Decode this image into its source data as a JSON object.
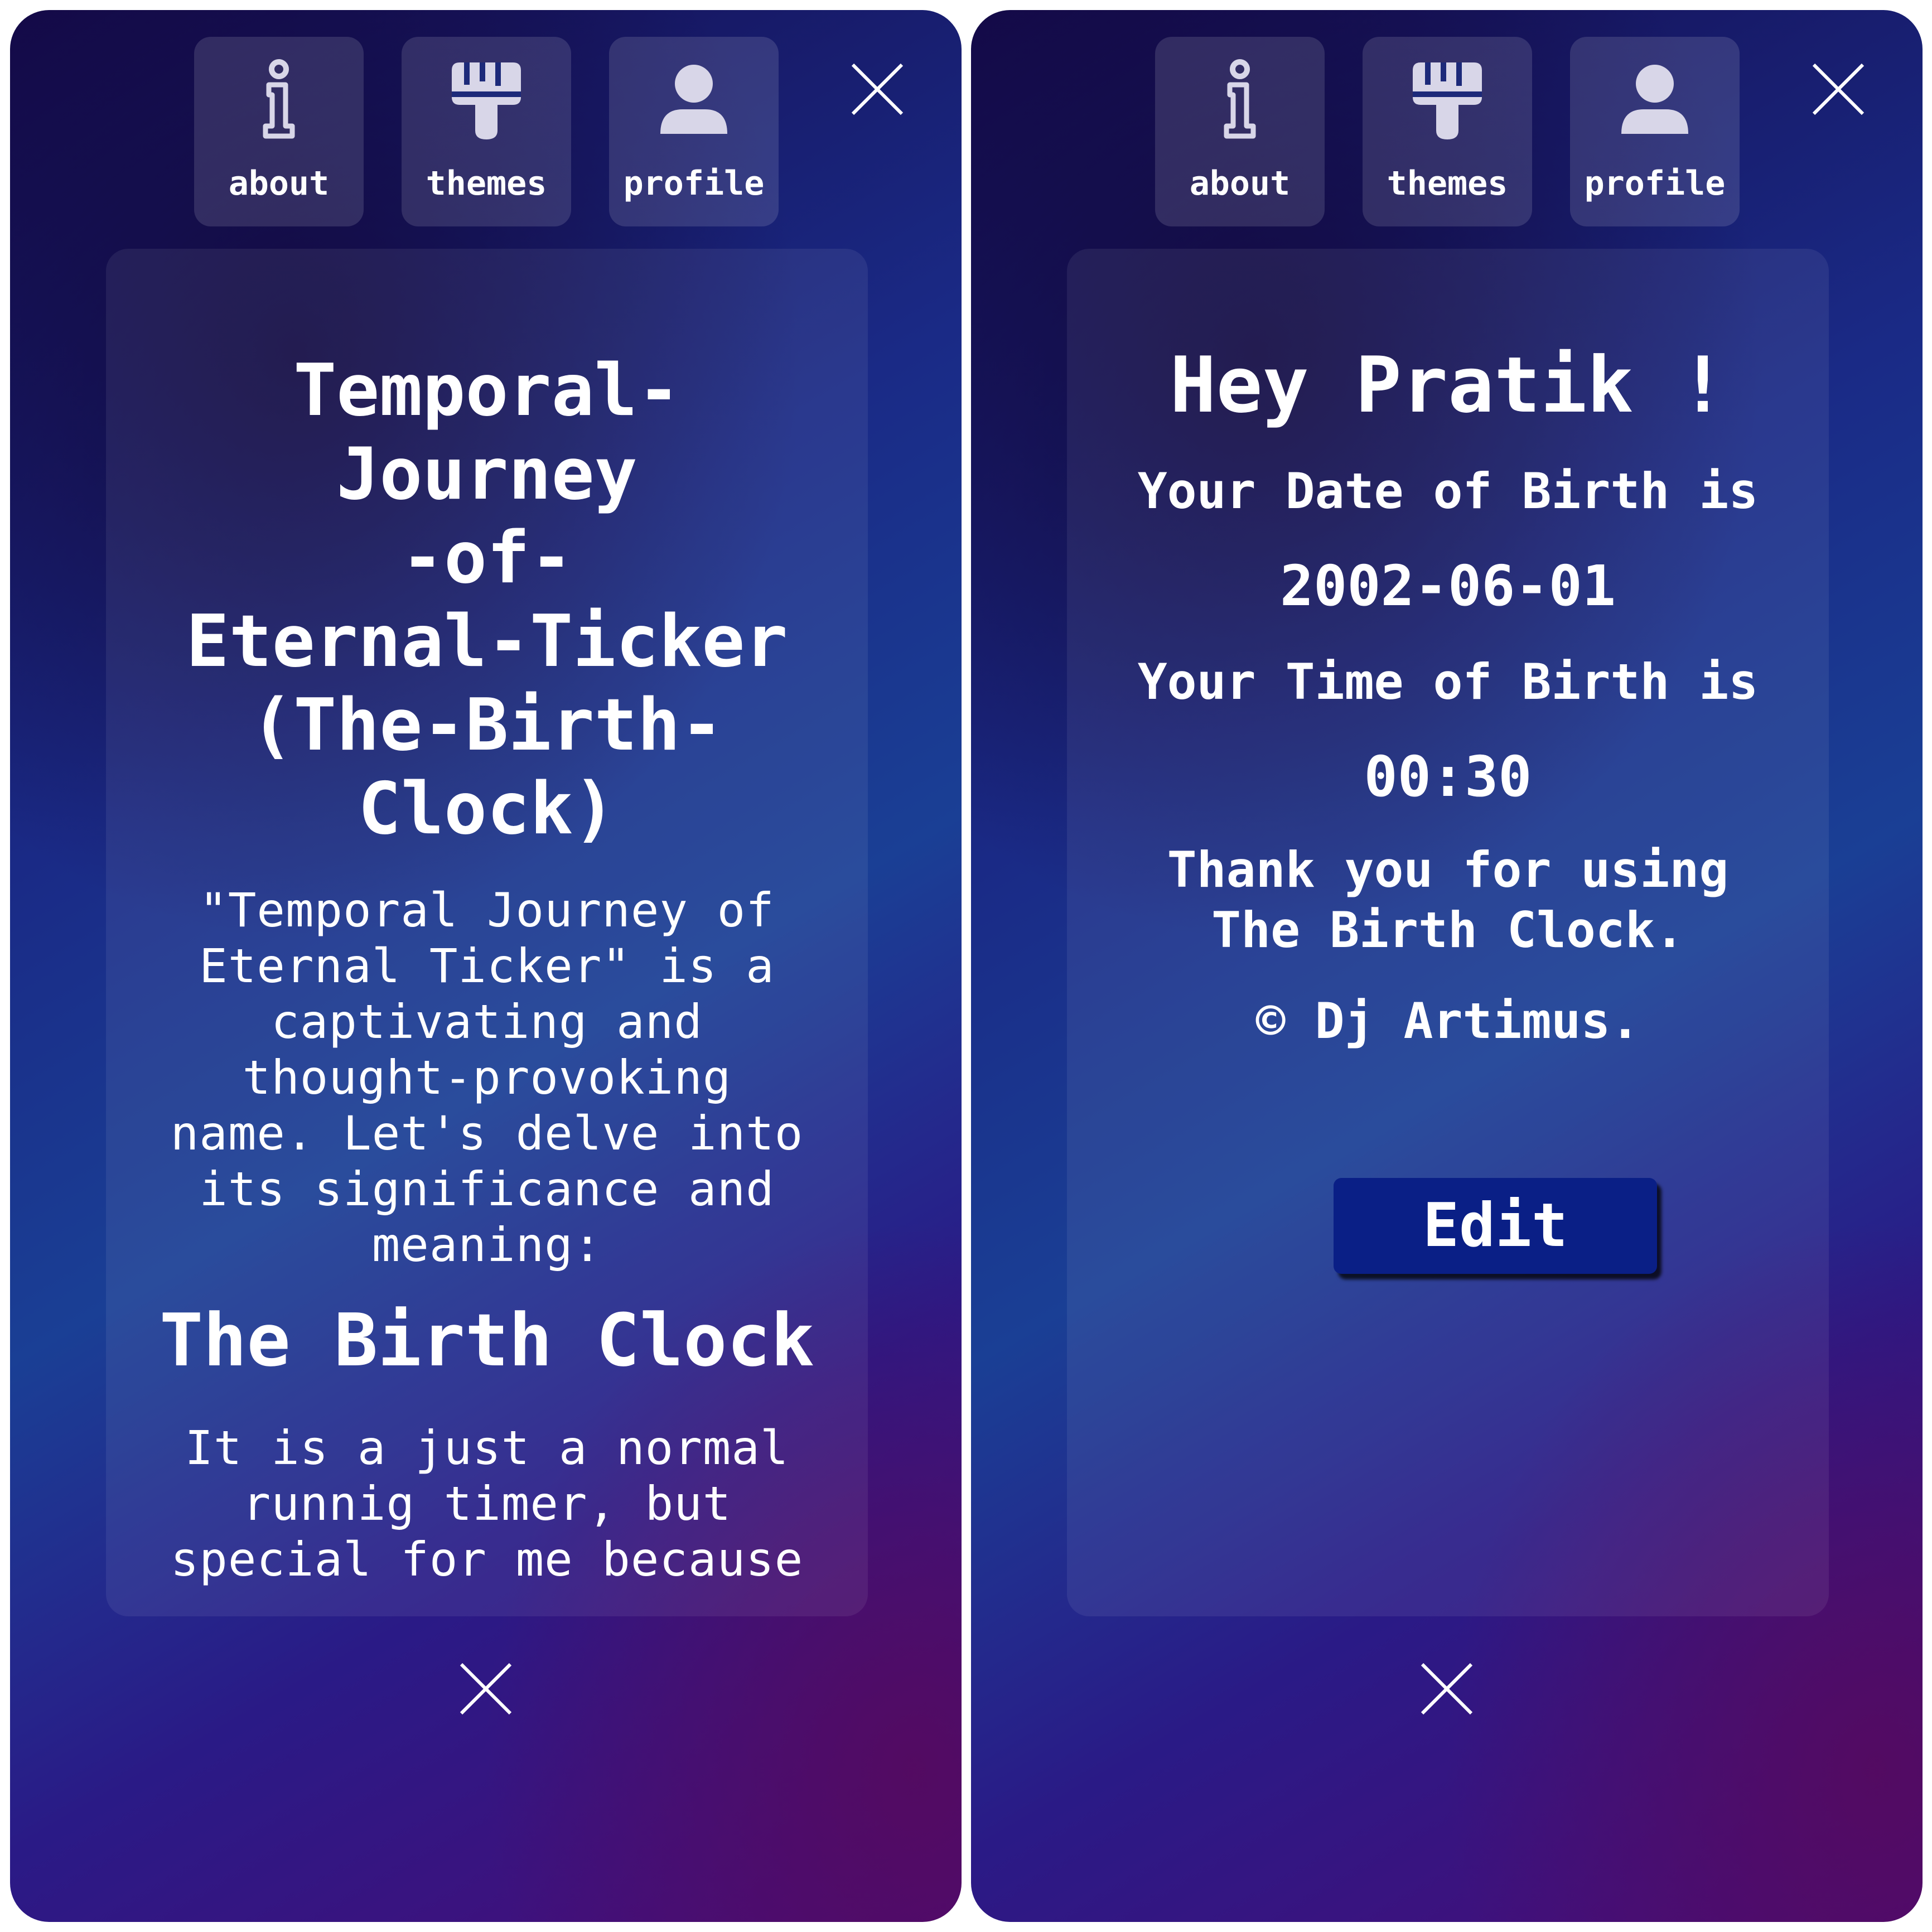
{
  "nav": {
    "about": {
      "label": "about",
      "icon": "info-icon"
    },
    "themes": {
      "label": "themes",
      "icon": "paint-brush-icon"
    },
    "profile": {
      "label": "profile",
      "icon": "user-icon"
    }
  },
  "left": {
    "title": "Temporal-\nJourney\n-of-\nEternal-Ticker\n(The-Birth-\nClock)",
    "intro": "\"Temporal Journey of Eternal Ticker\" is a captivating and thought-provoking name. Let's delve into its significance and meaning:",
    "section_heading": "The Birth Clock",
    "section_text": "It is a just a normal runnig timer, but special for me because"
  },
  "right": {
    "greeting": "Hey Pratik !",
    "dob_label": "Your Date of Birth is",
    "dob_value": "2002-06-01",
    "tob_label": "Your Time of Birth is",
    "tob_value": "00:30",
    "thanks": "Thank you for using The Birth Clock.",
    "credit": "© Dj Artimus.",
    "edit_label": "Edit"
  },
  "colors": {
    "background_start": "#140a4a",
    "background_mid": "#1a3f95",
    "background_end": "#4a0c78",
    "button_bg": "#0a1f86",
    "nav_icon": "#d8d6e8",
    "text": "#ffffff"
  }
}
